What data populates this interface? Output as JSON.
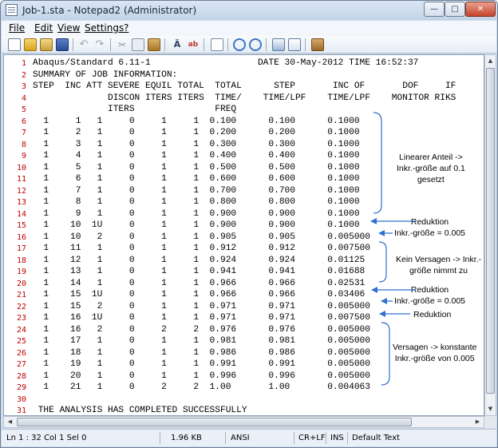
{
  "window": {
    "title": "Job-1.sta - Notepad2 (Administrator)",
    "minimize_glyph": "—",
    "maximize_glyph": "□",
    "close_glyph": "✕"
  },
  "menu": {
    "items": [
      {
        "label": "File",
        "accel": "F"
      },
      {
        "label": "Edit",
        "accel": "E"
      },
      {
        "label": "View",
        "accel": "V"
      },
      {
        "label": "Settings",
        "accel": "S"
      },
      {
        "label": "?",
        "accel": "?"
      }
    ]
  },
  "toolbar": {
    "icons": [
      "new-file-icon",
      "open-folder-icon",
      "browse-icon",
      "save-icon",
      "undo-icon",
      "redo-icon",
      "cut-icon",
      "copy-icon",
      "paste-icon",
      "find-icon",
      "replace-icon",
      "word-wrap-icon",
      "zoom-in-icon",
      "zoom-out-icon",
      "select-scheme-icon",
      "customize-scheme-icon",
      "exit-icon"
    ]
  },
  "editor": {
    "lines": [
      "Abaqus/Standard 6.11-1                    DATE 30-May-2012 TIME 16:52:37",
      "SUMMARY OF JOB INFORMATION:",
      "STEP  INC ATT SEVERE EQUIL TOTAL  TOTAL      STEP       INC OF       DOF     IF",
      "              DISCON ITERS ITERS  TIME/    TIME/LPF    TIME/LPF    MONITOR RIKS",
      "              ITERS               FREQ",
      "  1     1   1     0     1     1  0.100      0.100      0.1000",
      "  1     2   1     0     1     1  0.200      0.200      0.1000",
      "  1     3   1     0     1     1  0.300      0.300      0.1000",
      "  1     4   1     0     1     1  0.400      0.400      0.1000",
      "  1     5   1     0     1     1  0.500      0.500      0.1000",
      "  1     6   1     0     1     1  0.600      0.600      0.1000",
      "  1     7   1     0     1     1  0.700      0.700      0.1000",
      "  1     8   1     0     1     1  0.800      0.800      0.1000",
      "  1     9   1     0     1     1  0.900      0.900      0.1000",
      "  1    10  1U     0     1     1  0.900      0.900      0.1000",
      "  1    10   2     0     1     1  0.905      0.905      0.005000",
      "  1    11   1     0     1     1  0.912      0.912      0.007500",
      "  1    12   1     0     1     1  0.924      0.924      0.01125",
      "  1    13   1     0     1     1  0.941      0.941      0.01688",
      "  1    14   1     0     1     1  0.966      0.966      0.02531",
      "  1    15  1U     0     1     1  0.966      0.966      0.03406",
      "  1    15   2     0     1     1  0.971      0.971      0.005000",
      "  1    16  1U     0     1     1  0.971      0.971      0.007500",
      "  1    16   2     0     2     2  0.976      0.976      0.005000",
      "  1    17   1     0     1     1  0.981      0.981      0.005000",
      "  1    18   1     0     1     1  0.986      0.986      0.005000",
      "  1    19   1     0     1     1  0.991      0.991      0.005000",
      "  1    20   1     0     1     1  0.996      0.996      0.005000",
      "  1    21   1     0     2     2  1.00       1.00       0.004063",
      "",
      " THE ANALYSIS HAS COMPLETED SUCCESSFULLY"
    ]
  },
  "annotations": [
    {
      "text": "Linearer Anteil ->\nInkr.-größe auf 0.1\ngesetzt"
    },
    {
      "text": "Reduktion\nInkr.-größe = 0.005"
    },
    {
      "text": "Kein Versagen -> Inkr.-\ngröße nimmt zu"
    },
    {
      "text": "Reduktion\nInkr.-größe = 0.005"
    },
    {
      "text": "Reduktion"
    },
    {
      "text": "Versagen -> konstante\nInkr.-größe von 0.005"
    }
  ],
  "statusbar": {
    "position": "Ln 1 : 32   Col 1   Sel 0",
    "size": "1.96 KB",
    "encoding": "ANSI",
    "line_endings": "CR+LF",
    "insert_mode": "INS",
    "scheme": "Default Text"
  },
  "colors": {
    "line_numbers": "#c00000",
    "annotation_lines": "#2f6fd0"
  }
}
